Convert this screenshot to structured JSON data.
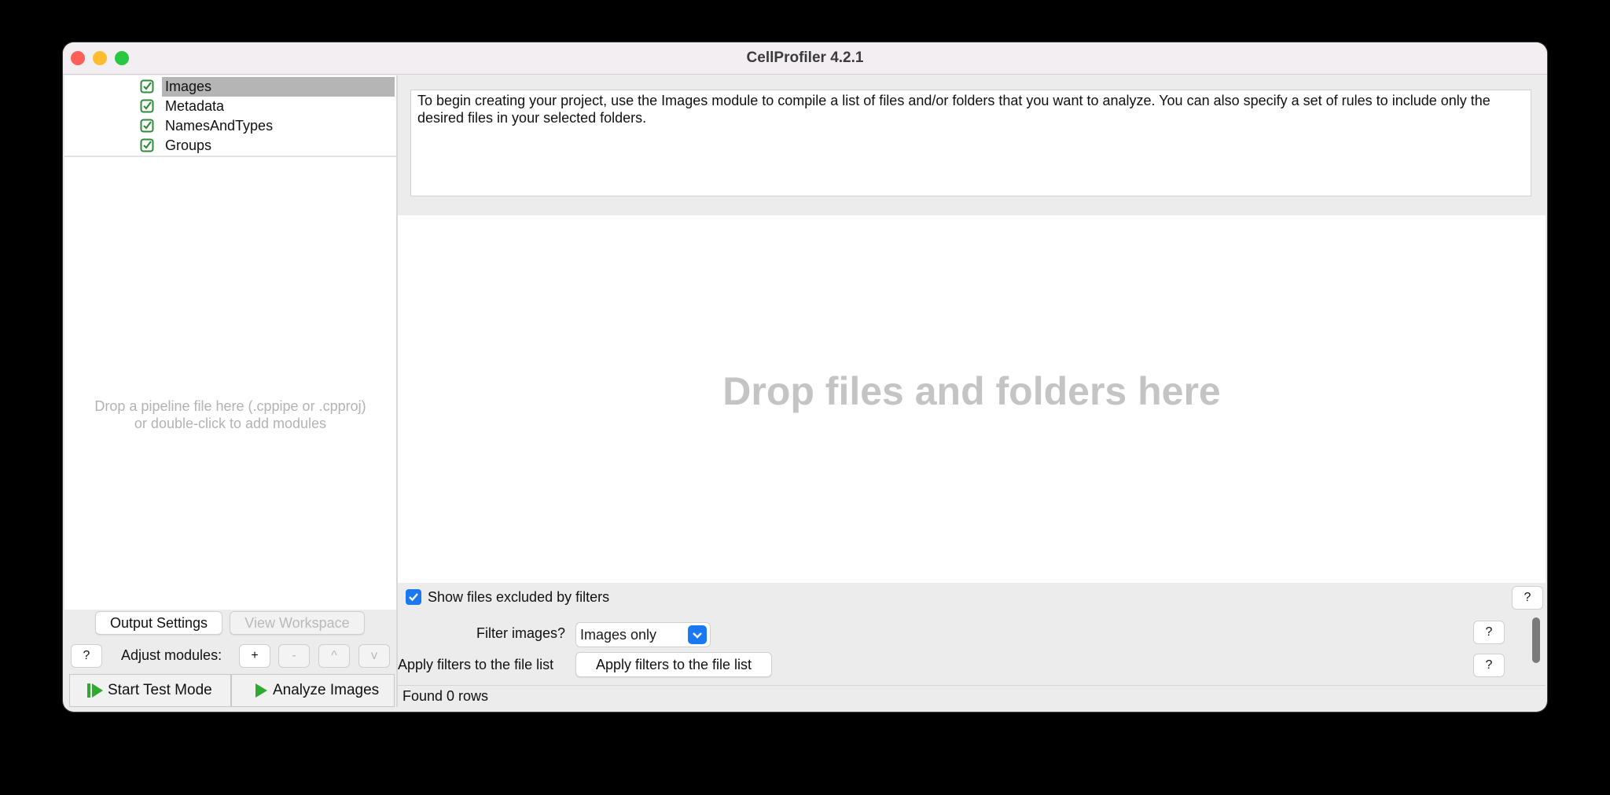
{
  "window": {
    "title": "CellProfiler 4.2.1"
  },
  "modules": [
    {
      "label": "Images",
      "checked": true,
      "selected": true
    },
    {
      "label": "Metadata",
      "checked": true,
      "selected": false
    },
    {
      "label": "NamesAndTypes",
      "checked": true,
      "selected": false
    },
    {
      "label": "Groups",
      "checked": true,
      "selected": false
    }
  ],
  "pipeline_drop_hint": {
    "line1": "Drop a pipeline file here (.cppipe or .cpproj)",
    "line2": "or double-click to add modules"
  },
  "left_controls": {
    "output_settings": "Output Settings",
    "view_workspace": "View Workspace",
    "help": "?",
    "adjust_modules": "Adjust modules:",
    "add": "+",
    "remove": "-",
    "up": "^",
    "down": "v",
    "start_test_mode": "Start Test Mode",
    "analyze_images": "Analyze Images"
  },
  "help_text": "To begin creating your project, use the Images module to compile a list of files and/or folders that you want to analyze. You can also specify a set of rules to include only the desired files in your selected folders.",
  "dropzone_text": "Drop files and folders here",
  "settings": {
    "show_excluded_label": "Show files excluded by filters",
    "show_excluded_checked": true,
    "filter_images_label": "Filter images?",
    "filter_images_value": "Images only",
    "apply_filters_label": "Apply filters to the file list",
    "apply_filters_button": "Apply filters to the file list",
    "help": "?"
  },
  "status": "Found 0 rows",
  "colors": {
    "accent": "#1a78f0",
    "check_green": "#2e8b3a",
    "play_green": "#2faa2f"
  },
  "icons": {
    "module_check": "checkbox-check-icon",
    "play": "play-icon",
    "test_mode": "step-play-icon"
  }
}
